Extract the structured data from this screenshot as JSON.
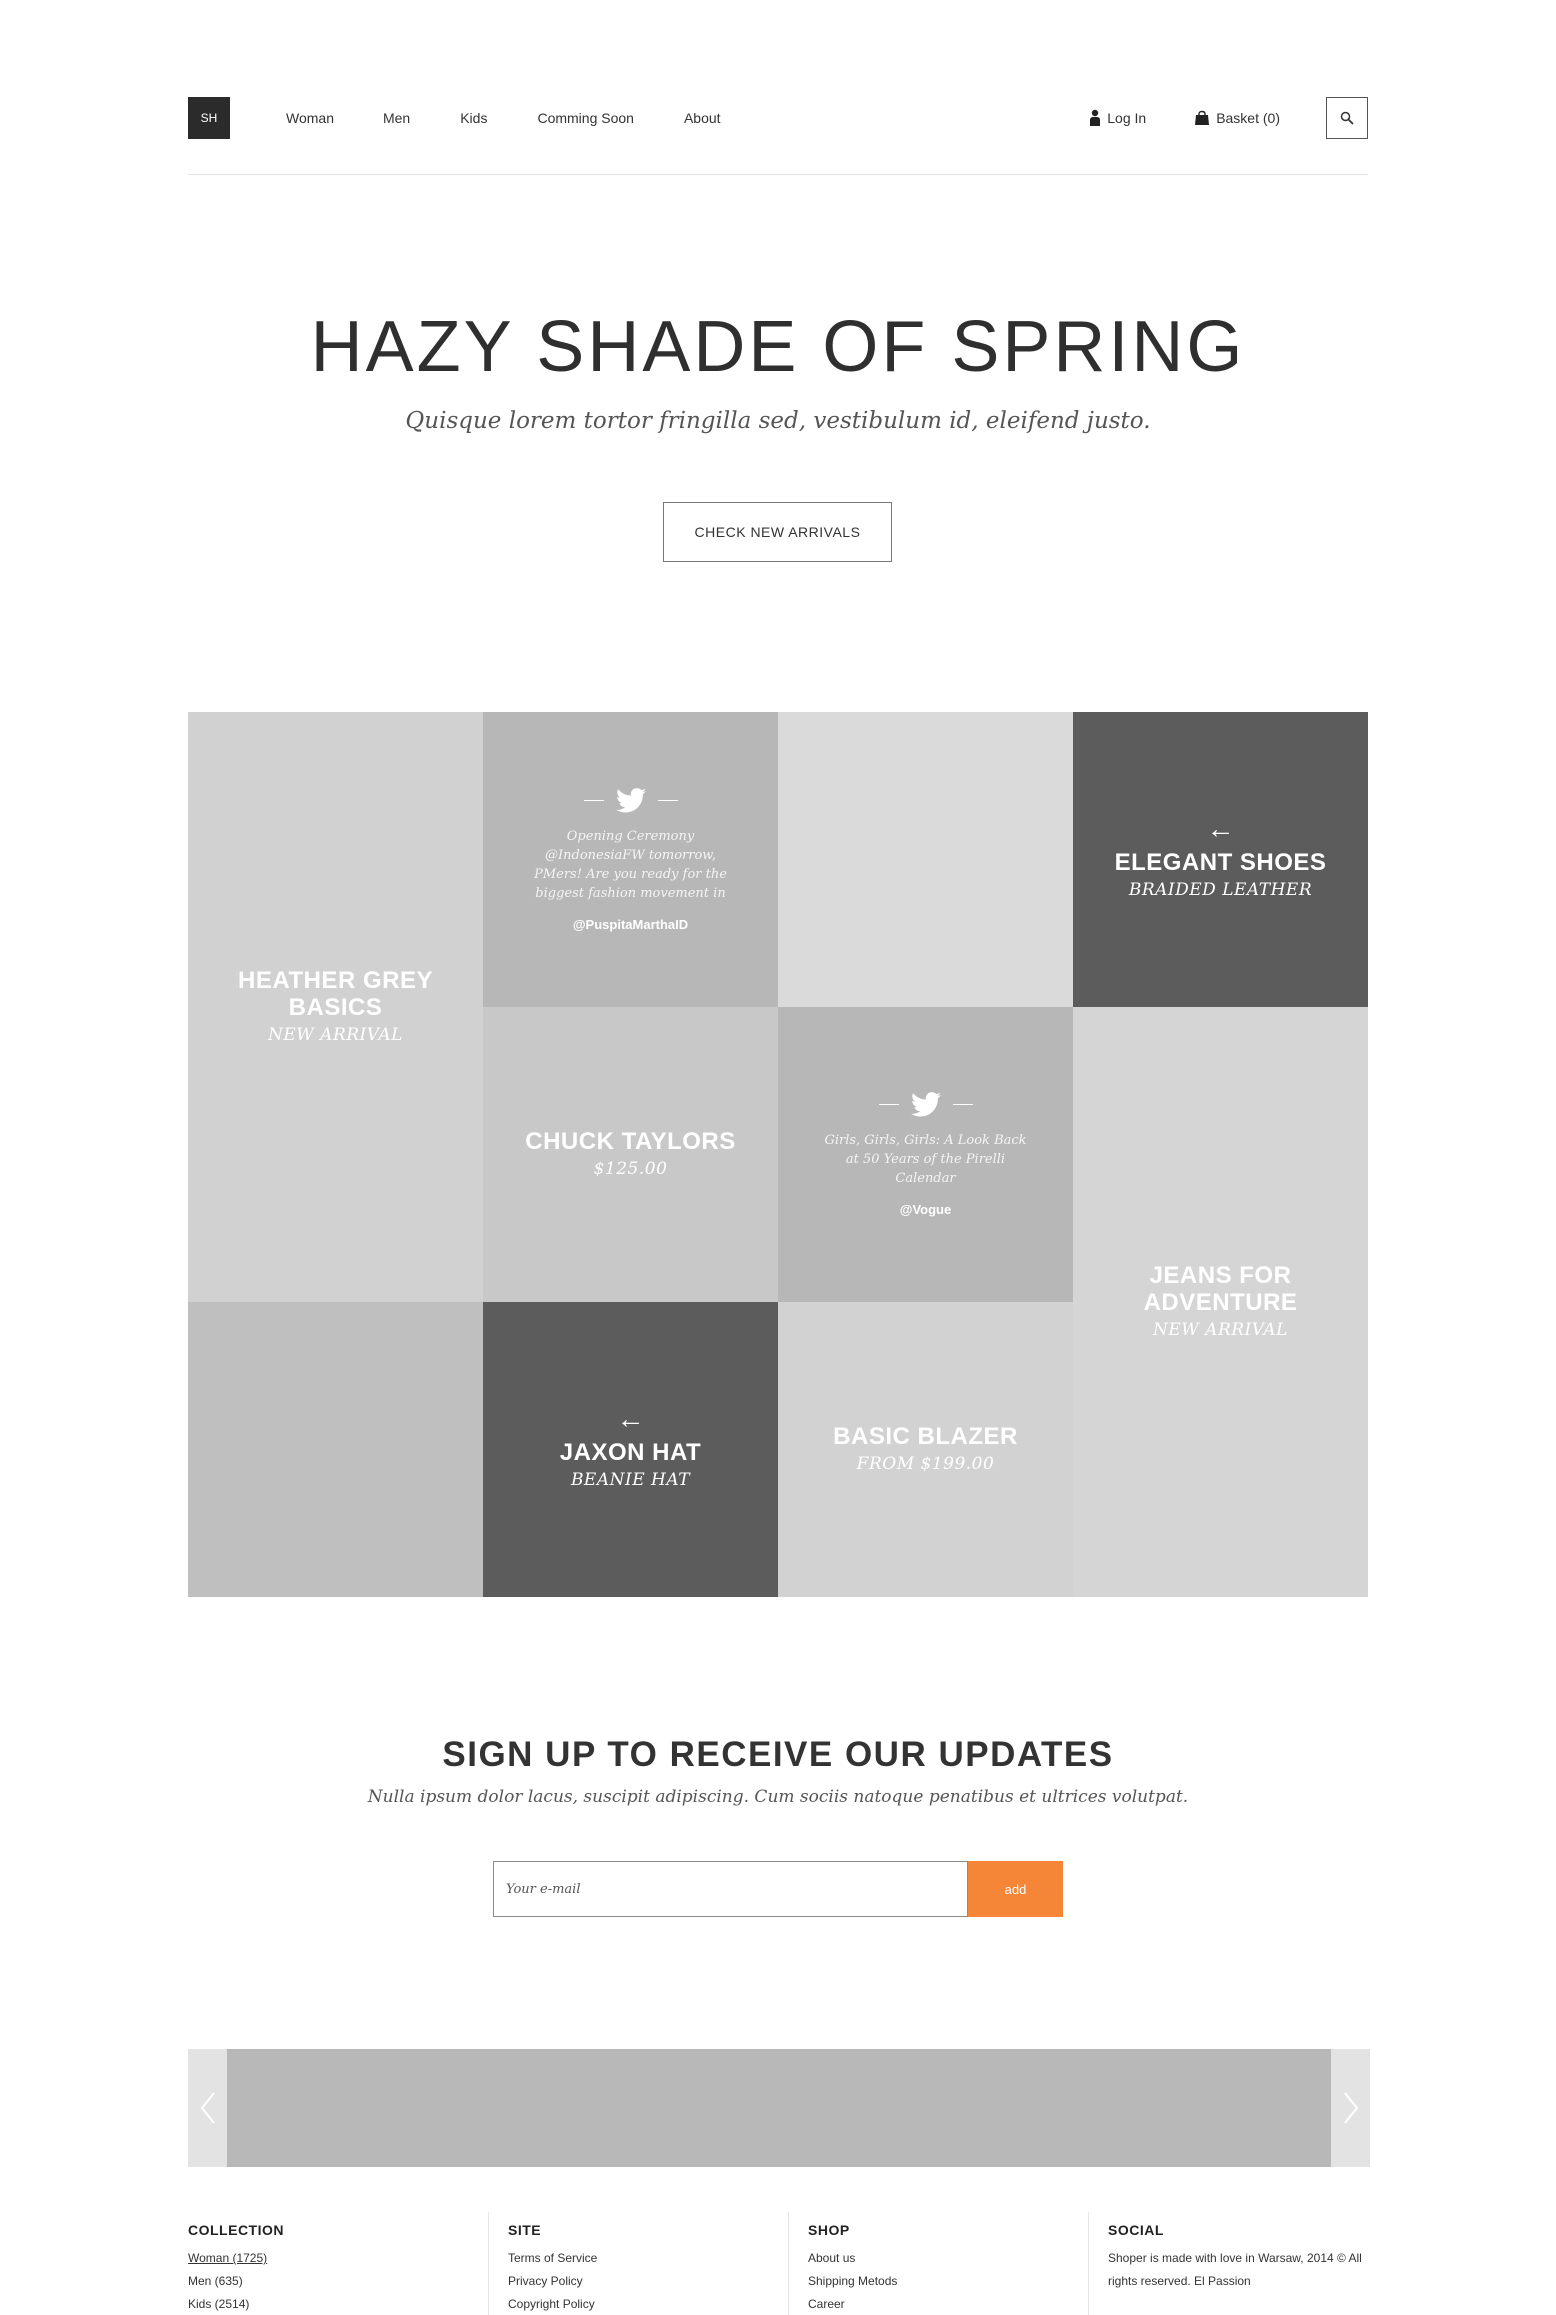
{
  "header": {
    "logo": "SH",
    "nav": [
      "Woman",
      "Men",
      "Kids",
      "Comming Soon",
      "About"
    ],
    "login_label": "Log In",
    "basket_label": "Basket (0)"
  },
  "hero": {
    "title": "HAZY SHADE OF SPRING",
    "subtitle": "Quisque lorem tortor fringilla sed, vestibulum id, eleifend justo.",
    "button_label": "CHECK NEW ARRIVALS"
  },
  "grid": {
    "heather": {
      "title": "HEATHER GREY BASICS",
      "sub": "NEW ARRIVAL"
    },
    "tweet1": {
      "text": "Opening Ceremony @IndonesiaFW tomorrow, PMers! Are you ready for the biggest fashion movement in",
      "user": "@PuspitaMarthaID"
    },
    "shoes": {
      "arrow": "←",
      "title": "ELEGANT SHOES",
      "sub": "BRAIDED LEATHER"
    },
    "chuck": {
      "title": "CHUCK TAYLORS",
      "sub": "$125.00"
    },
    "tweet2": {
      "text": "Girls, Girls, Girls: A Look Back at 50 Years of the Pirelli Calendar",
      "user": "@Vogue"
    },
    "jeans": {
      "title": "JEANS FOR ADVENTURE",
      "sub": "NEW ARRIVAL"
    },
    "hat": {
      "arrow": "←",
      "title": "JAXON HAT",
      "sub": "BEANIE HAT"
    },
    "blazer": {
      "title": "BASIC BLAZER",
      "sub": "FROM $199.00"
    }
  },
  "signup": {
    "title": "SIGN UP TO RECEIVE OUR UPDATES",
    "subtitle": "Nulla ipsum dolor lacus, suscipit adipiscing. Cum sociis natoque penatibus et ultrices volutpat.",
    "placeholder": "Your e-mail",
    "button_label": "add"
  },
  "footer": {
    "collection": {
      "heading": "COLLECTION",
      "items": [
        "Woman (1725)",
        "Men (635)",
        "Kids (2514)"
      ]
    },
    "site": {
      "heading": "SITE",
      "items": [
        "Terms of Service",
        "Privacy Policy",
        "Copyright Policy"
      ]
    },
    "shop": {
      "heading": "SHOP",
      "items": [
        "About us",
        "Shipping Metods",
        "Career"
      ]
    },
    "social": {
      "heading": "SOCIAL",
      "text": "Shoper is made with love in Warsaw, 2014 © All rights reserved. El Passion"
    }
  },
  "colors": {
    "accent": "#f58537",
    "dark_tile": "#5c5c5c",
    "logo_bg": "#2b2b2b"
  },
  "icons": [
    "user-icon",
    "basket-icon",
    "search-icon",
    "twitter-icon",
    "arrow-left-icon",
    "chevron-left-icon",
    "chevron-right-icon"
  ]
}
